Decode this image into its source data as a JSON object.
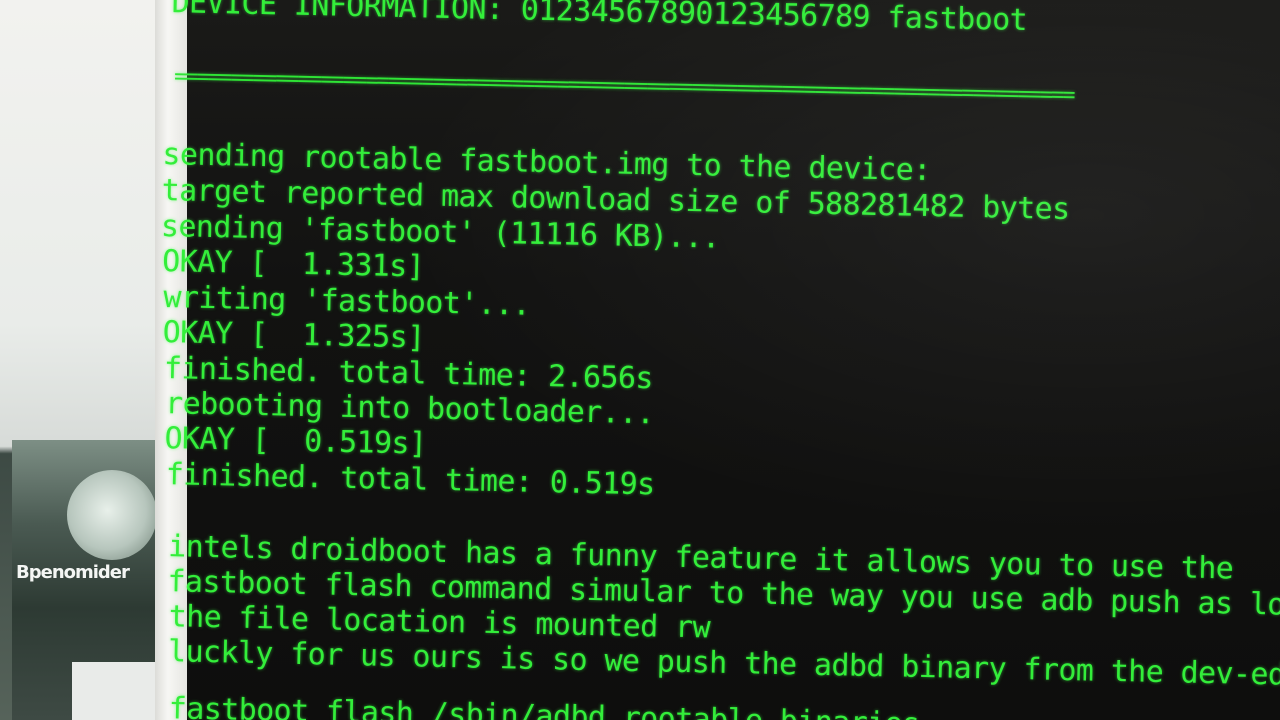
{
  "wallpaper": {
    "label": "Bpenomider"
  },
  "terminal": {
    "header": "DEVICE INFORMATION: 01234567890123456789 fastboot",
    "separator": "================================================================================",
    "lines": [
      "sending rootable fastboot.img to the device:",
      "target reported max download size of 588281482 bytes",
      "sending 'fastboot' (11116 KB)...",
      "OKAY [  1.331s]",
      "writing 'fastboot'...",
      "OKAY [  1.325s]",
      "finished. total time: 2.656s",
      "rebooting into bootloader...",
      "OKAY [  0.519s]",
      "finished. total time: 0.519s",
      "intels droidboot has a funny feature it allows you to use the",
      "fastboot flash command simular to the way you use adb push as long as",
      "the file location is mounted rw",
      "luckly for us ours is so we push the adbd binary from the dev-edition",
      "fastboot flash /sbin/adbd rootable_binaries"
    ]
  }
}
